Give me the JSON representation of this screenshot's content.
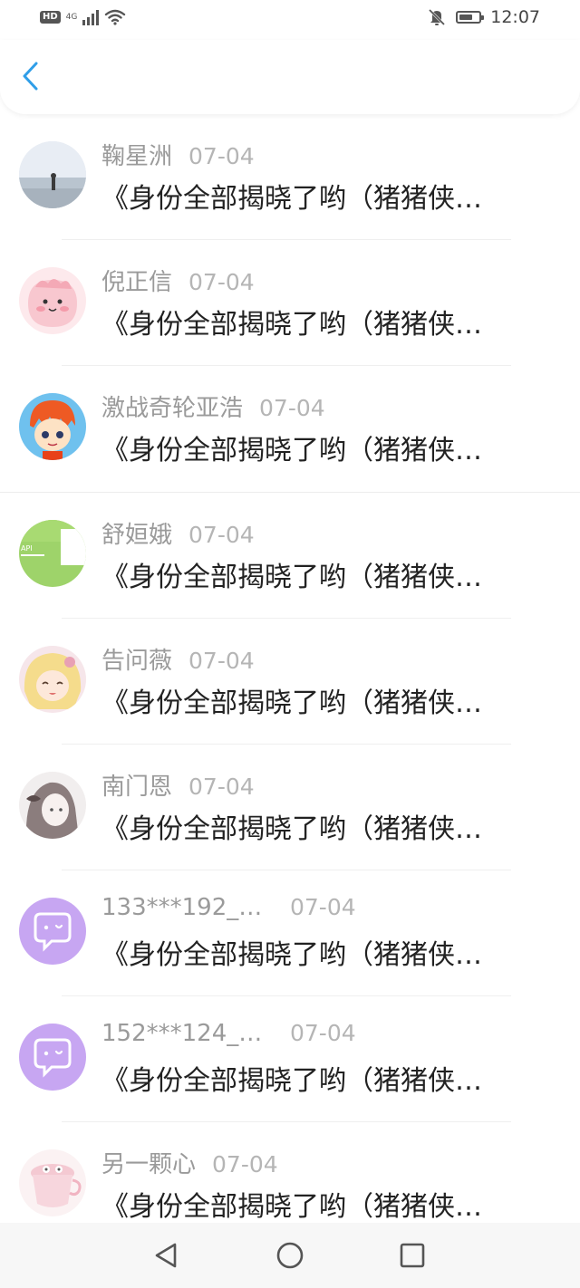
{
  "status_bar": {
    "hd": "HD",
    "network": "4G",
    "time": "12:07",
    "icons": [
      "signal-icon",
      "wifi-icon",
      "mute-bell-icon",
      "battery-icon"
    ]
  },
  "header": {
    "back_icon": "chevron-left-icon",
    "accent_color": "#2f9ee8"
  },
  "messages": [
    {
      "name": "鞠星洲",
      "date": "07-04",
      "text": "《身份全部揭晓了哟（猪猪侠…",
      "avatar": "beach-photo"
    },
    {
      "name": "倪正信",
      "date": "07-04",
      "text": "《身份全部揭晓了哟（猪猪侠…",
      "avatar": "pink-cartoon"
    },
    {
      "name": "激战奇轮亚浩",
      "date": "07-04",
      "text": "《身份全部揭晓了哟（猪猪侠…",
      "avatar": "anime-boy"
    },
    {
      "name": "舒姮娥",
      "date": "07-04",
      "text": "《身份全部揭晓了哟（猪猪侠…",
      "avatar": "green-api"
    },
    {
      "name": "告问薇",
      "date": "07-04",
      "text": "《身份全部揭晓了哟（猪猪侠…",
      "avatar": "anime-girl"
    },
    {
      "name": "南门恩",
      "date": "07-04",
      "text": "《身份全部揭晓了哟（猪猪侠…",
      "avatar": "sketch-girl"
    },
    {
      "name": "133***192_…",
      "date": "07-04",
      "text": "《身份全部揭晓了哟（猪猪侠…",
      "avatar": "purple-chat"
    },
    {
      "name": "152***124_…",
      "date": "07-04",
      "text": "《身份全部揭晓了哟（猪猪侠…",
      "avatar": "purple-chat"
    },
    {
      "name": "另一颗心",
      "date": "07-04",
      "text": "《身份全部揭晓了哟（猪猪侠…",
      "avatar": "pink-cup"
    }
  ],
  "nav_bar": {
    "icons": [
      "back-triangle-icon",
      "home-circle-icon",
      "recents-square-icon"
    ]
  }
}
